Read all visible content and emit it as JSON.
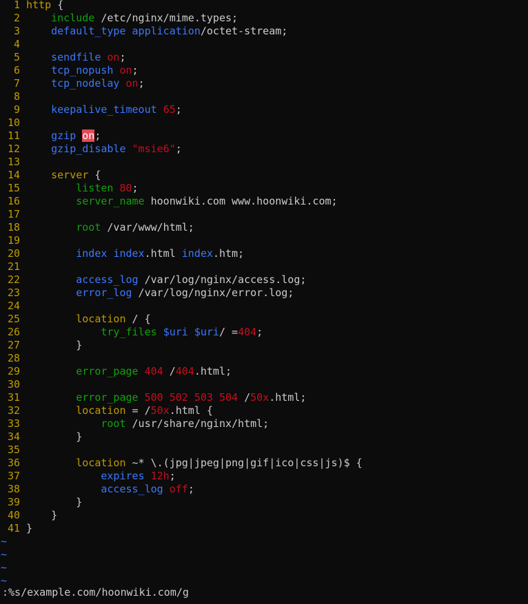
{
  "editor": {
    "colors": {
      "background": "#0c0c0c",
      "line_number": "#c19c00",
      "keyword": "#c19c00",
      "directive_green": "#13a10e",
      "directive_blue": "#3b78ff",
      "value_red": "#c50f1f",
      "text": "#cccccc",
      "search_highlight_bg": "#e74856",
      "tilde": "#3b78ff"
    },
    "lines": [
      {
        "num": "1",
        "tokens": [
          [
            "kw",
            "http"
          ],
          [
            "txt",
            " {"
          ]
        ]
      },
      {
        "num": "2",
        "tokens": [
          [
            "txt",
            "    "
          ],
          [
            "dir",
            "include"
          ],
          [
            "txt",
            " /etc/nginx/mime.types;"
          ]
        ]
      },
      {
        "num": "3",
        "tokens": [
          [
            "txt",
            "    "
          ],
          [
            "dir2",
            "default_type"
          ],
          [
            "txt",
            " "
          ],
          [
            "dir2",
            "application"
          ],
          [
            "txt",
            "/octet-stream;"
          ]
        ]
      },
      {
        "num": "4",
        "tokens": []
      },
      {
        "num": "5",
        "tokens": [
          [
            "txt",
            "    "
          ],
          [
            "dir2",
            "sendfile"
          ],
          [
            "txt",
            " "
          ],
          [
            "val",
            "on"
          ],
          [
            "txt",
            ";"
          ]
        ]
      },
      {
        "num": "6",
        "tokens": [
          [
            "txt",
            "    "
          ],
          [
            "dir2",
            "tcp_nopush"
          ],
          [
            "txt",
            " "
          ],
          [
            "val",
            "on"
          ],
          [
            "txt",
            ";"
          ]
        ]
      },
      {
        "num": "7",
        "tokens": [
          [
            "txt",
            "    "
          ],
          [
            "dir2",
            "tcp_nodelay"
          ],
          [
            "txt",
            " "
          ],
          [
            "val",
            "on"
          ],
          [
            "txt",
            ";"
          ]
        ]
      },
      {
        "num": "8",
        "tokens": []
      },
      {
        "num": "9",
        "tokens": [
          [
            "txt",
            "    "
          ],
          [
            "dir2",
            "keepalive_timeout"
          ],
          [
            "txt",
            " "
          ],
          [
            "val",
            "65"
          ],
          [
            "txt",
            ";"
          ]
        ]
      },
      {
        "num": "10",
        "tokens": []
      },
      {
        "num": "11",
        "tokens": [
          [
            "txt",
            "    "
          ],
          [
            "dir2",
            "gzip"
          ],
          [
            "txt",
            " "
          ],
          [
            "hl",
            "on"
          ],
          [
            "txt",
            ";"
          ]
        ]
      },
      {
        "num": "12",
        "tokens": [
          [
            "txt",
            "    "
          ],
          [
            "dir2",
            "gzip_disable"
          ],
          [
            "txt",
            " "
          ],
          [
            "val",
            "\"msie6\""
          ],
          [
            "txt",
            ";"
          ]
        ]
      },
      {
        "num": "13",
        "tokens": []
      },
      {
        "num": "14",
        "tokens": [
          [
            "txt",
            "    "
          ],
          [
            "kw",
            "server"
          ],
          [
            "txt",
            " {"
          ]
        ]
      },
      {
        "num": "15",
        "tokens": [
          [
            "txt",
            "        "
          ],
          [
            "dir",
            "listen"
          ],
          [
            "txt",
            " "
          ],
          [
            "val",
            "80"
          ],
          [
            "txt",
            ";"
          ]
        ]
      },
      {
        "num": "16",
        "tokens": [
          [
            "txt",
            "        "
          ],
          [
            "dir",
            "server_name"
          ],
          [
            "txt",
            " hoonwiki.com www.hoonwiki.com;"
          ]
        ]
      },
      {
        "num": "17",
        "tokens": []
      },
      {
        "num": "18",
        "tokens": [
          [
            "txt",
            "        "
          ],
          [
            "dir",
            "root"
          ],
          [
            "txt",
            " /var/www/html;"
          ]
        ]
      },
      {
        "num": "19",
        "tokens": []
      },
      {
        "num": "20",
        "tokens": [
          [
            "txt",
            "        "
          ],
          [
            "dir2",
            "index"
          ],
          [
            "txt",
            " "
          ],
          [
            "dir2",
            "index"
          ],
          [
            "txt",
            ".html "
          ],
          [
            "dir2",
            "index"
          ],
          [
            "txt",
            ".htm;"
          ]
        ]
      },
      {
        "num": "21",
        "tokens": []
      },
      {
        "num": "22",
        "tokens": [
          [
            "txt",
            "        "
          ],
          [
            "dir2",
            "access_log"
          ],
          [
            "txt",
            " /var/log/nginx/access.log;"
          ]
        ]
      },
      {
        "num": "23",
        "tokens": [
          [
            "txt",
            "        "
          ],
          [
            "dir2",
            "error_log"
          ],
          [
            "txt",
            " /var/log/nginx/error.log;"
          ]
        ]
      },
      {
        "num": "24",
        "tokens": []
      },
      {
        "num": "25",
        "tokens": [
          [
            "txt",
            "        "
          ],
          [
            "kw",
            "location"
          ],
          [
            "txt",
            " / {"
          ]
        ]
      },
      {
        "num": "26",
        "tokens": [
          [
            "txt",
            "            "
          ],
          [
            "dir",
            "try_files"
          ],
          [
            "txt",
            " "
          ],
          [
            "dir2",
            "$uri"
          ],
          [
            "txt",
            " "
          ],
          [
            "dir2",
            "$uri"
          ],
          [
            "txt",
            "/ ="
          ],
          [
            "val",
            "404"
          ],
          [
            "txt",
            ";"
          ]
        ]
      },
      {
        "num": "27",
        "tokens": [
          [
            "txt",
            "        }"
          ]
        ]
      },
      {
        "num": "28",
        "tokens": []
      },
      {
        "num": "29",
        "tokens": [
          [
            "txt",
            "        "
          ],
          [
            "dir",
            "error_page"
          ],
          [
            "txt",
            " "
          ],
          [
            "val",
            "404"
          ],
          [
            "txt",
            " /"
          ],
          [
            "val",
            "404"
          ],
          [
            "txt",
            ".html;"
          ]
        ]
      },
      {
        "num": "30",
        "tokens": []
      },
      {
        "num": "31",
        "tokens": [
          [
            "txt",
            "        "
          ],
          [
            "dir",
            "error_page"
          ],
          [
            "txt",
            " "
          ],
          [
            "val",
            "500 502 503 504"
          ],
          [
            "txt",
            " /"
          ],
          [
            "val",
            "50x"
          ],
          [
            "txt",
            ".html;"
          ]
        ]
      },
      {
        "num": "32",
        "tokens": [
          [
            "txt",
            "        "
          ],
          [
            "kw",
            "location"
          ],
          [
            "txt",
            " = /"
          ],
          [
            "val",
            "50x"
          ],
          [
            "txt",
            ".html {"
          ]
        ]
      },
      {
        "num": "33",
        "tokens": [
          [
            "txt",
            "            "
          ],
          [
            "dir",
            "root"
          ],
          [
            "txt",
            " /usr/share/nginx/html;"
          ]
        ]
      },
      {
        "num": "34",
        "tokens": [
          [
            "txt",
            "        }"
          ]
        ]
      },
      {
        "num": "35",
        "tokens": []
      },
      {
        "num": "36",
        "tokens": [
          [
            "txt",
            "        "
          ],
          [
            "kw",
            "location"
          ],
          [
            "txt",
            " ~* \\.(jpg|jpeg|png|gif|ico|css|js)$ {"
          ]
        ]
      },
      {
        "num": "37",
        "tokens": [
          [
            "txt",
            "            "
          ],
          [
            "dir2",
            "expires"
          ],
          [
            "txt",
            " "
          ],
          [
            "val",
            "12h"
          ],
          [
            "txt",
            ";"
          ]
        ]
      },
      {
        "num": "38",
        "tokens": [
          [
            "txt",
            "            "
          ],
          [
            "dir2",
            "access_log"
          ],
          [
            "txt",
            " "
          ],
          [
            "val",
            "off"
          ],
          [
            "txt",
            ";"
          ]
        ]
      },
      {
        "num": "39",
        "tokens": [
          [
            "txt",
            "        }"
          ]
        ]
      },
      {
        "num": "40",
        "tokens": [
          [
            "txt",
            "    }"
          ]
        ]
      },
      {
        "num": "41",
        "tokens": [
          [
            "txt",
            "}"
          ]
        ]
      }
    ],
    "empty_markers": [
      "~",
      "~",
      "~",
      "~"
    ]
  },
  "command_line": ":%s/example.com/hoonwiki.com/g"
}
